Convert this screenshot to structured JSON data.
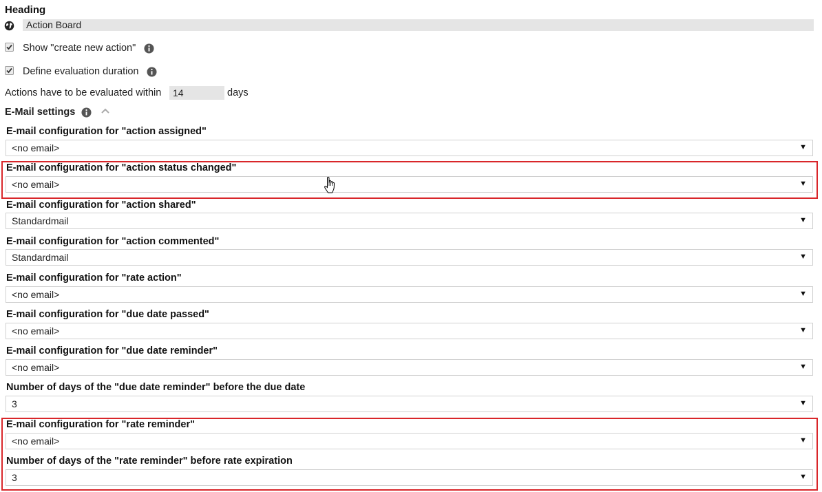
{
  "heading": {
    "label": "Heading",
    "title_value": "Action Board"
  },
  "options": {
    "show_create": {
      "label": "Show \"create new action\"",
      "checked": true
    },
    "define_duration": {
      "label": "Define evaluation duration",
      "checked": true
    }
  },
  "evaluation": {
    "prefix": "Actions have to be evaluated within",
    "value": "14",
    "suffix": "days"
  },
  "email_settings": {
    "title": "E-Mail settings"
  },
  "fields": [
    {
      "label": "E-mail configuration for \"action assigned\"",
      "value": "<no email>"
    },
    {
      "label": "E-mail configuration for \"action status changed\"",
      "value": "<no email>"
    },
    {
      "label": "E-mail configuration for \"action shared\"",
      "value": "Standardmail"
    },
    {
      "label": "E-mail configuration for \"action commented\"",
      "value": "Standardmail"
    },
    {
      "label": "E-mail configuration for \"rate action\"",
      "value": "<no email>"
    },
    {
      "label": "E-mail configuration for \"due date passed\"",
      "value": "<no email>"
    },
    {
      "label": "E-mail configuration for \"due date reminder\"",
      "value": "<no email>"
    },
    {
      "label": "Number of days of the \"due date reminder\" before the due date",
      "value": "3"
    },
    {
      "label": "E-mail configuration for \"rate reminder\"",
      "value": "<no email>"
    },
    {
      "label": "Number of days of the \"rate reminder\" before rate expiration",
      "value": "3"
    }
  ],
  "arrow_glyph": "▼",
  "colors": {
    "highlight": "#d9262a",
    "field_bg": "#e5e5e5",
    "info_icon": "#555555"
  }
}
